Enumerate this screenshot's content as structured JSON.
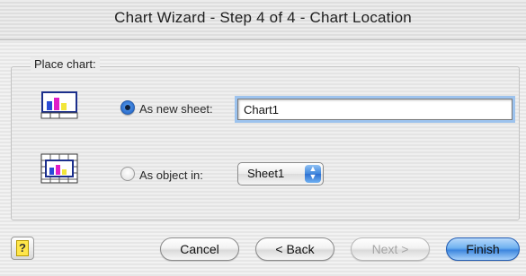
{
  "window": {
    "title": "Chart Wizard - Step 4 of 4 - Chart Location"
  },
  "group": {
    "label": "Place chart:"
  },
  "options": {
    "new_sheet": {
      "label": "As new sheet:",
      "value": "Chart1",
      "selected": true
    },
    "object_in": {
      "label": "As object in:",
      "value": "Sheet1",
      "selected": false
    }
  },
  "buttons": {
    "help": "?",
    "cancel": "Cancel",
    "back": "< Back",
    "next": "Next >",
    "finish": "Finish"
  },
  "colors": {
    "accent": "#3d86de",
    "chart_bar_blue": "#2a4bd6",
    "chart_bar_magenta": "#e01ec8",
    "chart_bar_yellow": "#f2e63a"
  }
}
